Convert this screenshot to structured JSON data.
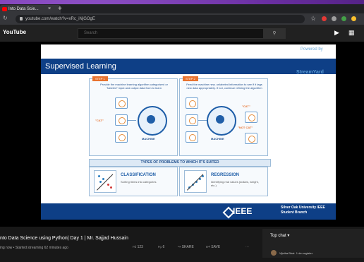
{
  "browser": {
    "tab_title": "Into Data Scie...",
    "tab_close": "×",
    "new_tab": "+",
    "url": "youtube.com/watch?v=xRc_iNjGOgE"
  },
  "youtube": {
    "logo": "YouTube",
    "search_placeholder": "Search",
    "search_button_icon": "search-icon"
  },
  "slide": {
    "title": "Supervised Learning",
    "watermark_top": "Powered by",
    "watermark": "StreamYard",
    "step1_label": "STEP 1",
    "step1_text": "Provide the machine learning algorithm categorized or \"labeled\" input and output data from to learn",
    "step2_label": "STEP 2",
    "step2_text": "Feed the machine new, unlabeled information to see if it tags new data appropriately. If not, continue refining the algorithm",
    "cat_label": "\"CAT\"",
    "not_cat_label": "\"NOT CAT\"",
    "machine_label": "MACHINE",
    "types_header": "TYPES OF PROBLEMS TO WHICH IT'S SUITED",
    "classification_title": "CLASSIFICATION",
    "classification_text": "Sorting items into categories",
    "regression_title": "REGRESSION",
    "regression_text": "Identifying real values (dollars, weight, etc.)",
    "ieee": "IEEE",
    "university": "Silver Oak University IEEE Student Branch"
  },
  "video": {
    "title": "nto Data Science using Python| Day 1 | Mr. Sajjad Hussain",
    "meta": "ing now • Started streaming 62 minutes ago",
    "likes": "123",
    "dislikes": "6",
    "share": "SHARE",
    "save": "SAVE",
    "more": "⋯"
  },
  "chat": {
    "header": "Top chat",
    "author": "Vijetha Bhat",
    "message": "1 dm register"
  }
}
